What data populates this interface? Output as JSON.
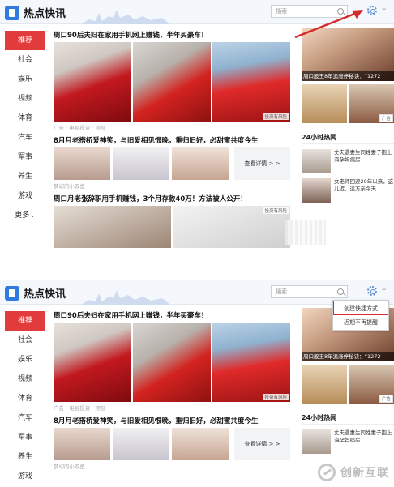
{
  "app": {
    "title": "热点快讯"
  },
  "search": {
    "placeholder": "搜索"
  },
  "sidebar": {
    "items": [
      {
        "label": "推荐",
        "active": true
      },
      {
        "label": "社会"
      },
      {
        "label": "娱乐"
      },
      {
        "label": "视频"
      },
      {
        "label": "体育"
      },
      {
        "label": "汽车"
      },
      {
        "label": "军事"
      },
      {
        "label": "养生"
      },
      {
        "label": "游戏"
      },
      {
        "label": "更多⌄"
      }
    ]
  },
  "sidebar2": {
    "items": [
      {
        "label": "推荐",
        "active": true
      },
      {
        "label": "社会"
      },
      {
        "label": "娱乐"
      },
      {
        "label": "视频"
      },
      {
        "label": "体育"
      },
      {
        "label": "汽车"
      },
      {
        "label": "军事"
      },
      {
        "label": "养生"
      },
      {
        "label": "游戏"
      }
    ]
  },
  "feed": {
    "article1": {
      "headline": "周口90后夫妇在家用手机网上赚钱，半年买豪车！",
      "meta": "广告 · 电视投资 · 顶部",
      "ad_tag": "投资有风险"
    },
    "article2": {
      "headline": "8月月老搭桥爱神笑，与旧爱相见恨晚，重归旧好，必甜蜜共度今生",
      "meta": "梦幻的小双鱼",
      "details_label": "查看详情 > >"
    },
    "article3": {
      "headline": "周口月老张辞职用手机赚钱，3个月存款40万！方法被人公开！",
      "ad_tag": "投资有风险"
    }
  },
  "right": {
    "video_caption": "周口股王8年追涨停秘诀：“1272",
    "ad_chip": "广告",
    "hot_title": "24小时热闻",
    "hot_items": [
      {
        "text": "丈夫遇妻生同姓妻子抱上海孕妈病房"
      },
      {
        "text": "女老师回迎20年以来，这儿迟，远方亲今天"
      }
    ]
  },
  "popup": {
    "items": [
      {
        "label": "创建快捷方式",
        "highlight": true
      },
      {
        "label": "近期不再提醒"
      }
    ]
  },
  "watermark": {
    "text": "创新互联"
  },
  "colors": {
    "accent": "#e23b3b",
    "brand": "#2f7be0",
    "highlight": "#d62b2b"
  }
}
